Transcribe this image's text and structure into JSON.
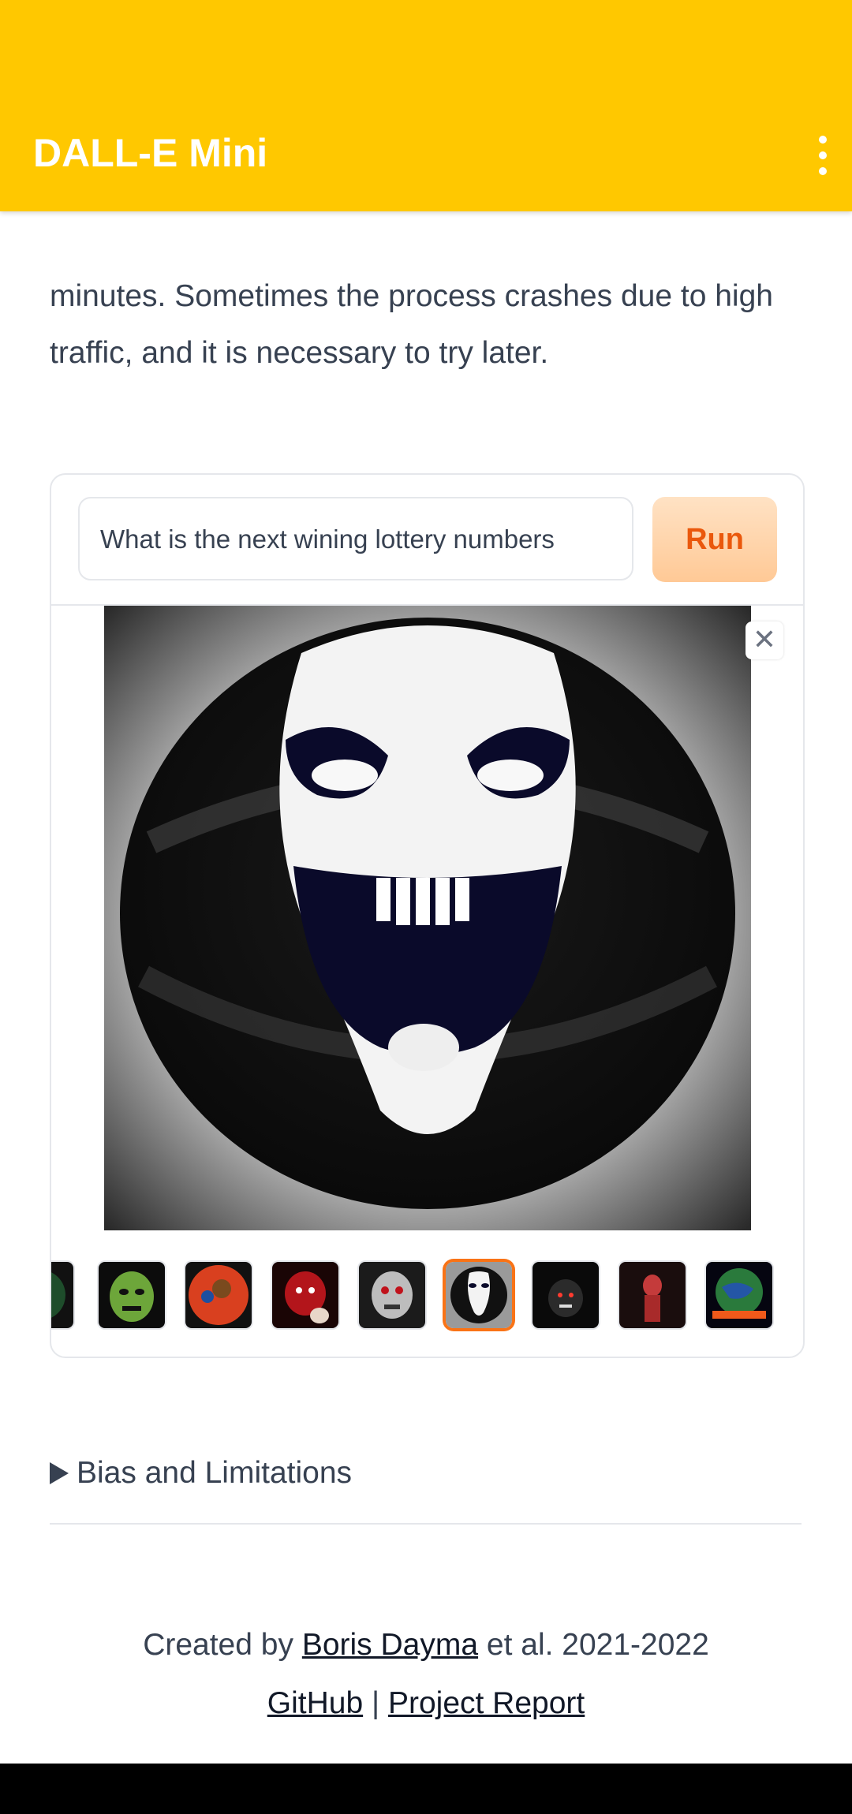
{
  "app": {
    "title": "DALL-E Mini"
  },
  "content": {
    "paragraph_line2": "minutes. Sometimes the process crashes due to high",
    "paragraph_line3": "traffic, and it is necessary to try later."
  },
  "demo": {
    "prompt_value": "What is the next wining lottery numbers",
    "run_label": "Run",
    "close_icon": "✕",
    "thumbnails": [
      {
        "name": "globe-partial"
      },
      {
        "name": "green-goblin-face"
      },
      {
        "name": "red-circle-figure"
      },
      {
        "name": "red-demon-face"
      },
      {
        "name": "grey-skull-face"
      },
      {
        "name": "white-clown-skull",
        "selected": true
      },
      {
        "name": "dark-creature"
      },
      {
        "name": "red-figure"
      },
      {
        "name": "earth-fire"
      }
    ]
  },
  "bias": {
    "label": "Bias and Limitations"
  },
  "footer": {
    "created_by": "Created by",
    "author_link": "Boris Dayma",
    "suffix": "et al. 2021-2022",
    "github_link": "GitHub",
    "separator": "|",
    "report_link": "Project Report"
  },
  "colors": {
    "appbar": "#ffc800",
    "run_text": "#ea580c",
    "accent": "#f97316"
  }
}
